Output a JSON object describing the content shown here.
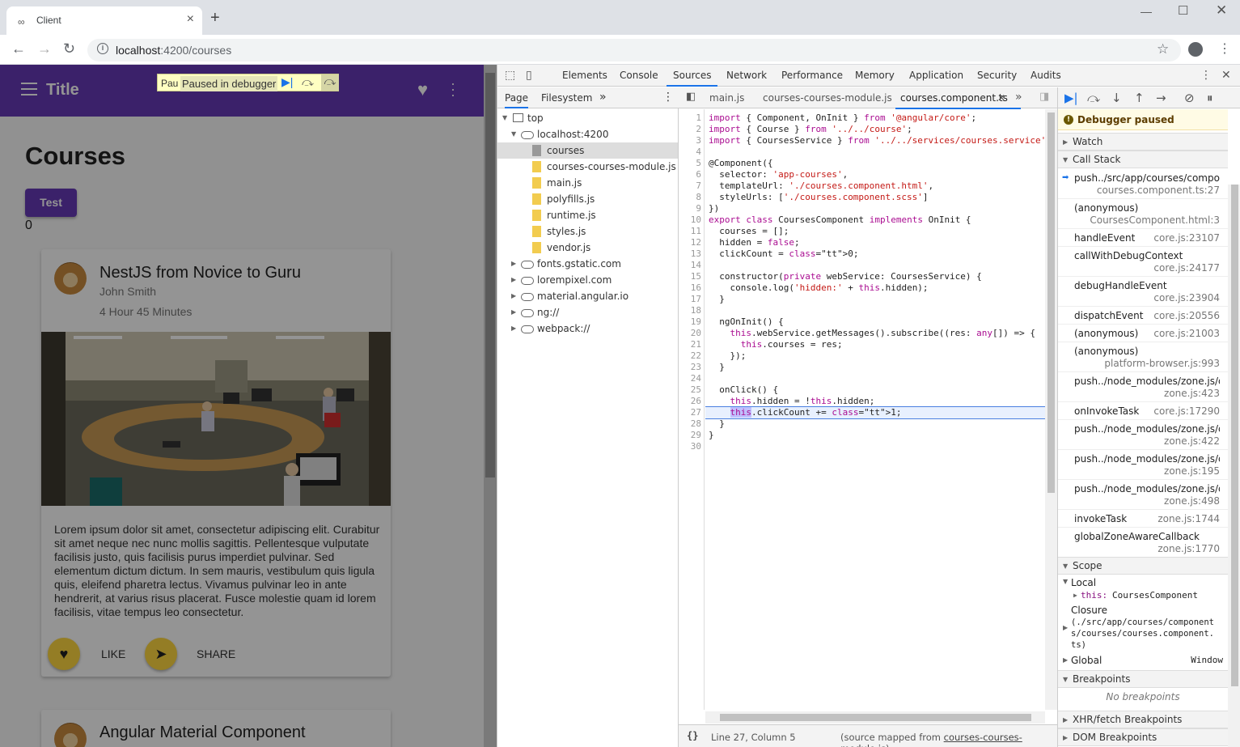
{
  "browser": {
    "tab_title": "Client",
    "new_tab": "+",
    "url_host": "localhost",
    "url_path": ":4200/courses"
  },
  "app": {
    "title": "Title",
    "paused_cut": "Pau",
    "paused_message": "Paused in debugger",
    "heading": "Courses",
    "test_button": "Test",
    "counter": "0",
    "card1": {
      "title": "NestJS from Novice to Guru",
      "author": "John Smith",
      "duration": "4 Hour 45 Minutes",
      "body": "Lorem ipsum dolor sit amet, consectetur adipiscing elit. Curabitur sit amet neque nec nunc mollis sagittis. Pellentesque vulputate facilisis justo, quis facilisis purus imperdiet pulvinar. Sed elementum dictum dictum. In sem mauris, vestibulum quis ligula quis, eleifend pharetra lectus. Vivamus pulvinar leo in ante hendrerit, at varius risus placerat. Fusce molestie quam id lorem facilisis, vitae tempus leo consectetur.",
      "like": "LIKE",
      "share": "SHARE"
    },
    "card2": {
      "title": "Angular Material Component"
    }
  },
  "devtools": {
    "tabs": [
      "Elements",
      "Console",
      "Sources",
      "Network",
      "Performance",
      "Memory",
      "Application",
      "Security",
      "Audits"
    ],
    "active_tab": "Sources",
    "navigator": {
      "tabs": [
        "Page",
        "Filesystem"
      ],
      "more": "»",
      "tree": {
        "top": "top",
        "host": "localhost:4200",
        "files": [
          "courses",
          "courses-courses-module.js",
          "main.js",
          "polyfills.js",
          "runtime.js",
          "styles.js",
          "vendor.js"
        ],
        "domains": [
          "fonts.gstatic.com",
          "lorempixel.com",
          "material.angular.io",
          "ng://",
          "webpack://"
        ]
      }
    },
    "editor": {
      "tabs": [
        "main.js",
        "courses-courses-module.js",
        "courses.component.ts"
      ],
      "active_tab": "courses.component.ts",
      "status_pretty": "{}",
      "status_position": "Line 27, Column 5",
      "status_map_prefix": "(source mapped from ",
      "status_map_file": "courses-courses-module.js",
      "status_map_suffix": ")",
      "lines": [
        "import { Component, OnInit } from '@angular/core';",
        "import { Course } from '../../course';",
        "import { CoursesService } from '../../services/courses.service';",
        "",
        "@Component({",
        "  selector: 'app-courses',",
        "  templateUrl: './courses.component.html',",
        "  styleUrls: ['./courses.component.scss']",
        "})",
        "export class CoursesComponent implements OnInit {",
        "  courses = [];",
        "  hidden = false;",
        "  clickCount = 0;",
        "",
        "  constructor(private webService: CoursesService) {",
        "    console.log('hidden:' + this.hidden);",
        "  }",
        "",
        "  ngOnInit() {",
        "    this.webService.getMessages().subscribe((res: any[]) => {",
        "      this.courses = res;",
        "    });",
        "  }",
        "",
        "  onClick() {",
        "    this.hidden = !this.hidden;",
        "    this.clickCount += 1;",
        "  }",
        "}",
        ""
      ]
    },
    "sidebar": {
      "paused": "Debugger paused",
      "watch": "Watch",
      "call_stack": "Call Stack",
      "frames": [
        {
          "fn": "push../src/app/courses/compon...",
          "loc": "courses.component.ts:27"
        },
        {
          "fn": "(anonymous)",
          "loc": "CoursesComponent.html:3"
        },
        {
          "fn": "handleEvent",
          "loc": "core.js:23107"
        },
        {
          "fn": "callWithDebugContext",
          "loc": "core.js:24177"
        },
        {
          "fn": "debugHandleEvent",
          "loc": "core.js:23904"
        },
        {
          "fn": "dispatchEvent",
          "loc": "core.js:20556"
        },
        {
          "fn": "(anonymous)",
          "loc": "core.js:21003"
        },
        {
          "fn": "(anonymous)",
          "loc": "platform-browser.js:993"
        },
        {
          "fn": "push../node_modules/zone.js/di...",
          "loc": "zone.js:423"
        },
        {
          "fn": "onInvokeTask",
          "loc": "core.js:17290"
        },
        {
          "fn": "push../node_modules/zone.js/di...",
          "loc": "zone.js:422"
        },
        {
          "fn": "push../node_modules/zone.js/di...",
          "loc": "zone.js:195"
        },
        {
          "fn": "push../node_modules/zone.js/di...",
          "loc": "zone.js:498"
        },
        {
          "fn": "invokeTask",
          "loc": "zone.js:1744"
        },
        {
          "fn": "globalZoneAwareCallback",
          "loc": "zone.js:1770"
        }
      ],
      "scope": "Scope",
      "local": "Local",
      "this_key": "this:",
      "this_val": "CoursesComponent",
      "closure_label": "Closure",
      "closure_path": "(./src/app/courses/component\ns/courses/courses.component.\nts)",
      "global": "Global",
      "global_val": "Window",
      "breakpoints": "Breakpoints",
      "no_breakpoints": "No breakpoints",
      "xhr_breakpoints": "XHR/fetch Breakpoints",
      "dom_breakpoints": "DOM Breakpoints"
    }
  }
}
